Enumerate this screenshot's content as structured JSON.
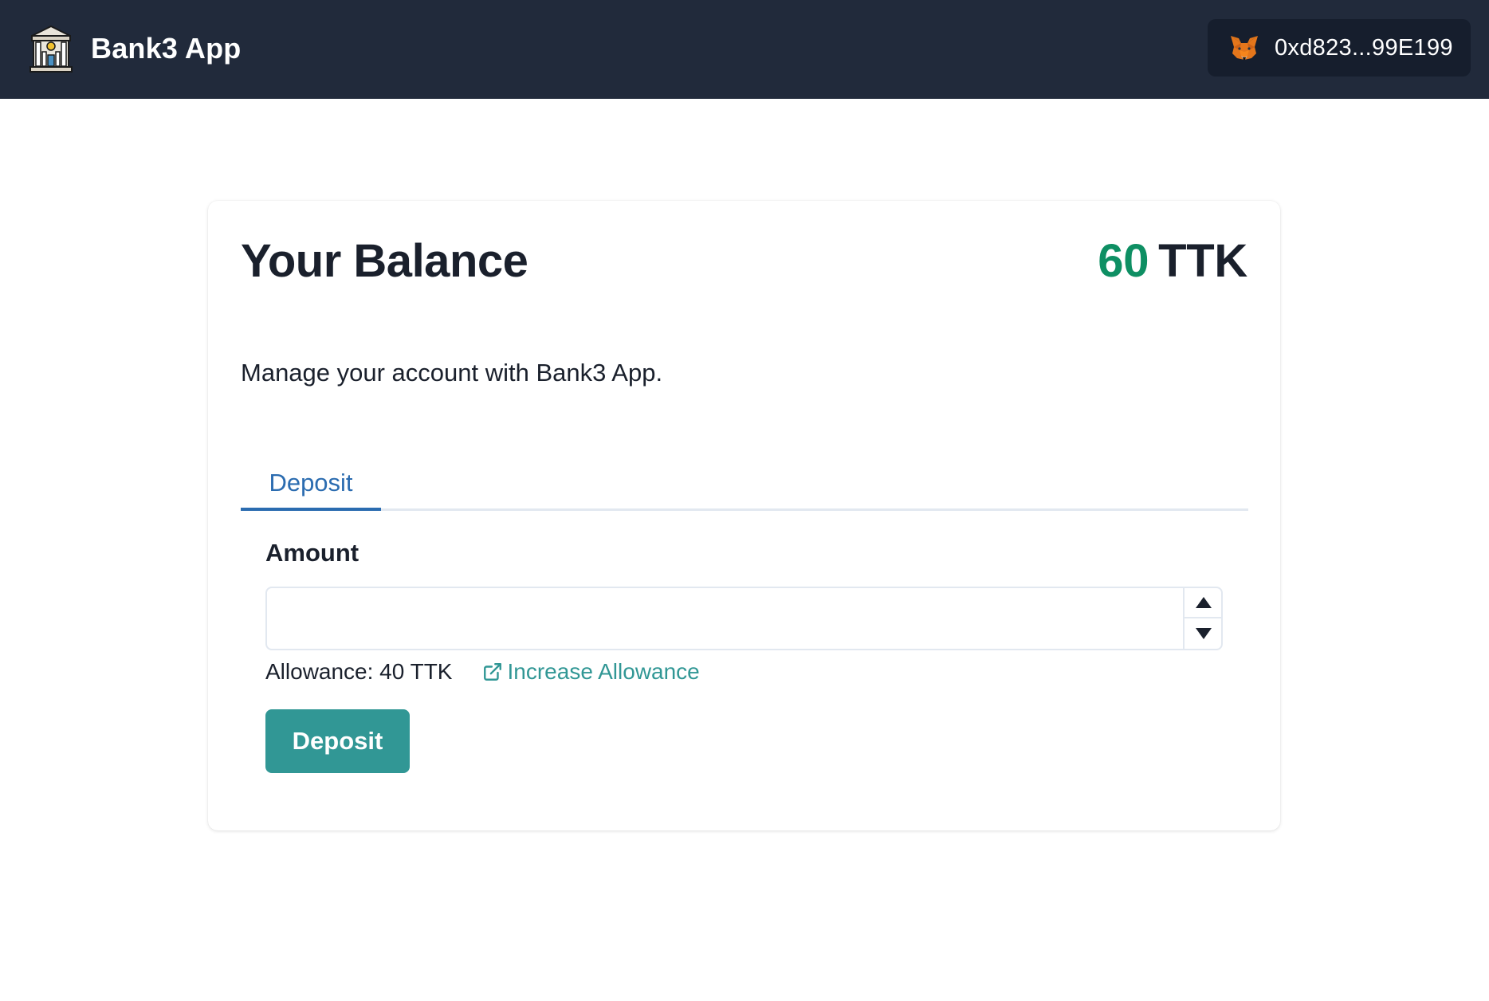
{
  "header": {
    "app_title": "Bank3 App",
    "logo_icon": "bank-building-icon",
    "wallet": {
      "icon": "metamask-fox-icon",
      "address": "0xd823...99E199"
    }
  },
  "card": {
    "title": "Your Balance",
    "balance": {
      "amount": "60",
      "unit": "TTK",
      "amount_color": "#0e8f63"
    },
    "subtitle": "Manage your account with Bank3 App.",
    "tabs": [
      {
        "label": "Deposit",
        "active": true
      }
    ],
    "form": {
      "amount_label": "Amount",
      "amount_value": "",
      "allowance_text": "Allowance: 40 TTK",
      "increase_link_label": "Increase Allowance",
      "submit_label": "Deposit"
    }
  },
  "colors": {
    "topbar": "#212a3b",
    "wallet_bg": "#161e2d",
    "accent_teal": "#319795",
    "tab_blue": "#2b6cb0"
  }
}
